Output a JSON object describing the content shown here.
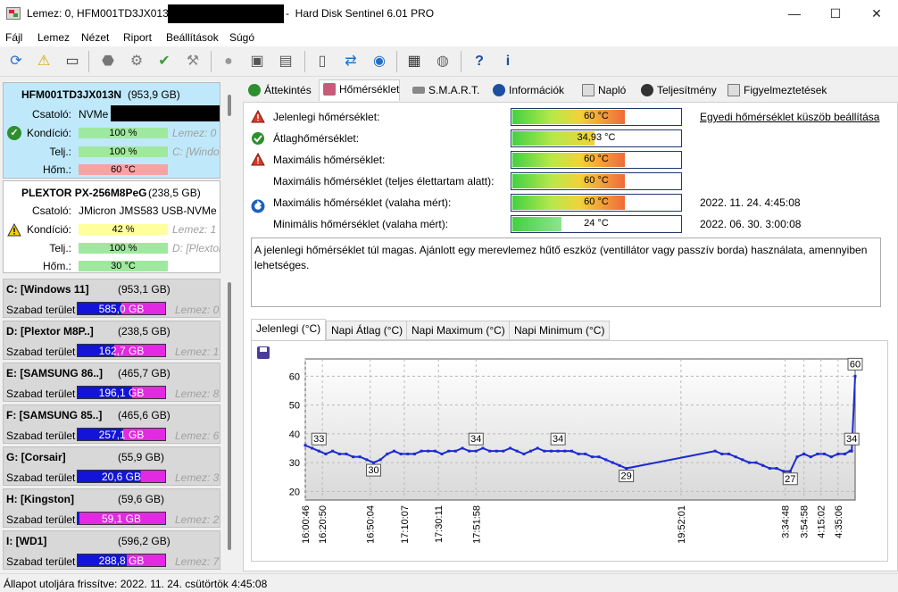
{
  "window": {
    "title_left": "Lemez: 0, HFM001TD3JX013N",
    "title_right": "-  Hard Disk Sentinel 6.01 PRO",
    "min_glyph": "—",
    "max_glyph": "☐",
    "close_glyph": "✕"
  },
  "menu": [
    "Fájl",
    "Lemez",
    "Nézet",
    "Riport",
    "Beállítások",
    "Súgó"
  ],
  "disks": [
    {
      "name": "HFM001TD3JX013N",
      "size": "(953,9 GB)",
      "iface_label": "Csatoló:",
      "iface": "NVMe",
      "health_label": "Kondíció:",
      "health": "100 %",
      "health_disk": "Lemez: 0",
      "perf_label": "Telj.:",
      "perf": "100 %",
      "perf_drive": "C: [Windo",
      "temp_label": "Hőm.:",
      "temp": "60 °C"
    },
    {
      "name": "PLEXTOR PX-256M8PeG",
      "size": "(238,5 GB)",
      "iface_label": "Csatoló:",
      "iface": "JMicron JMS583 USB-NVMe (U",
      "health_label": "Kondíció:",
      "health": "42 %",
      "health_disk": "Lemez: 1",
      "perf_label": "Telj.:",
      "perf": "100 %",
      "perf_drive": "D: [Plextor",
      "temp_label": "Hőm.:",
      "temp": "30 °C"
    }
  ],
  "partitions": [
    {
      "name": "C: [Windows 11]",
      "size": "(953,1 GB)",
      "free_label": "Szabad terület",
      "free": "585,0 GB",
      "disk": "Lemez: 0",
      "fill": 0.5
    },
    {
      "name": "D: [Plextor M8P..]",
      "size": "(238,5 GB)",
      "free_label": "Szabad terület",
      "free": "162,7 GB",
      "disk": "Lemez: 1",
      "fill": 0.42
    },
    {
      "name": "E: [SAMSUNG 86..]",
      "size": "(465,7 GB)",
      "free_label": "Szabad terület",
      "free": "196,1 GB",
      "disk": "Lemez: 8",
      "fill": 0.62
    },
    {
      "name": "F: [SAMSUNG 85..]",
      "size": "(465,6 GB)",
      "free_label": "Szabad terület",
      "free": "257,1 GB",
      "disk": "Lemez: 6",
      "fill": 0.52
    },
    {
      "name": "G: [Corsair]",
      "size": "(55,9 GB)",
      "free_label": "Szabad terület",
      "free": "20,6 GB",
      "disk": "Lemez: 3",
      "fill": 0.72
    },
    {
      "name": "H: [Kingston]",
      "size": "(59,6 GB)",
      "free_label": "Szabad terület",
      "free": "59,1 GB",
      "disk": "Lemez: 2",
      "fill": 0.02
    },
    {
      "name": "I: [WD1]",
      "size": "(596,2 GB)",
      "free_label": "Szabad terület",
      "free": "288,8 GB",
      "disk": "Lemez: 7",
      "fill": 0.56
    }
  ],
  "tabs": [
    "Áttekintés",
    "Hőmérséklet",
    "S.M.A.R.T.",
    "Információk",
    "Napló",
    "Teljesítmény",
    "Figyelmeztetések"
  ],
  "temps": [
    {
      "label": "Jelenlegi hőmérséklet:",
      "value": "60 °C",
      "level": 0.82,
      "extra": "Egyedi hőmérséklet küszöb beállítása",
      "icon": "warning"
    },
    {
      "label": "Átlaghőmérséklet:",
      "value": "34,93 °C",
      "level": 0.6,
      "extra": "",
      "icon": "ok"
    },
    {
      "label": "Maximális hőmérséklet:",
      "value": "60 °C",
      "level": 0.82,
      "extra": "",
      "icon": "warning"
    },
    {
      "label": "Maximális hőmérséklet (teljes élettartam alatt):",
      "value": "60 °C",
      "level": 0.82,
      "extra": "",
      "icon": "none"
    },
    {
      "label": "Maximális hőmérséklet (valaha mért):",
      "value": "60 °C",
      "level": 0.82,
      "extra": "2022. 11. 24. 4:45:08",
      "icon": "reset"
    },
    {
      "label": "Minimális hőmérséklet (valaha mért):",
      "value": "24 °C",
      "level": 0.36,
      "extra": "2022. 06. 30. 3:00:08",
      "icon": "none"
    }
  ],
  "warning_text": "A jelenlegi hőmérséklet túl magas. Ajánlott egy merevlemez hűtő eszköz (ventillátor vagy passzív borda) használata, amennyiben lehetséges.",
  "subtabs": [
    "Jelenlegi (°C)",
    "Napi Átlag (°C)",
    "Napi Maximum (°C)",
    "Napi Minimum (°C)"
  ],
  "chart_data": {
    "type": "line",
    "ylim": [
      17,
      66
    ],
    "yticks": [
      20,
      30,
      40,
      50,
      60
    ],
    "xticks": [
      "16:00:46",
      "16:20:50",
      "16:50:04",
      "17:10:07",
      "17:30:11",
      "17:51:58",
      "19:52:01",
      "3:34:48",
      "3:54:58",
      "4:15:02",
      "4:35:06"
    ],
    "x": [
      0,
      4,
      8,
      12,
      16,
      20,
      24,
      28,
      32,
      36,
      40,
      44,
      48,
      52,
      56,
      60,
      64,
      68,
      72,
      76,
      80,
      84,
      88,
      92,
      96,
      100,
      104,
      108,
      112,
      116,
      120,
      124,
      128,
      132,
      136,
      140,
      144,
      148,
      152,
      156,
      160,
      164,
      168,
      172,
      176,
      180,
      184,
      188,
      240,
      244,
      248,
      252,
      256,
      260,
      264,
      268,
      272,
      276,
      280,
      284,
      288,
      292,
      296,
      300,
      304,
      308,
      312,
      316,
      319,
      320,
      322
    ],
    "values": [
      36,
      35,
      34,
      33,
      34,
      33,
      33,
      32,
      32,
      31,
      30,
      31,
      33,
      34,
      33,
      33,
      33,
      34,
      34,
      34,
      33,
      34,
      34,
      35,
      34,
      34,
      35,
      34,
      34,
      34,
      35,
      34,
      33,
      34,
      35,
      34,
      34,
      34,
      34,
      34,
      33,
      33,
      32,
      32,
      31,
      30,
      29,
      28,
      34,
      33,
      33,
      32,
      31,
      30,
      30,
      29,
      28,
      28,
      27,
      27,
      32,
      33,
      32,
      33,
      33,
      32,
      33,
      33,
      34,
      34,
      60
    ],
    "point_labels": [
      "33",
      "30",
      "34",
      "34",
      "29",
      "27",
      "34",
      "60"
    ]
  }
}
